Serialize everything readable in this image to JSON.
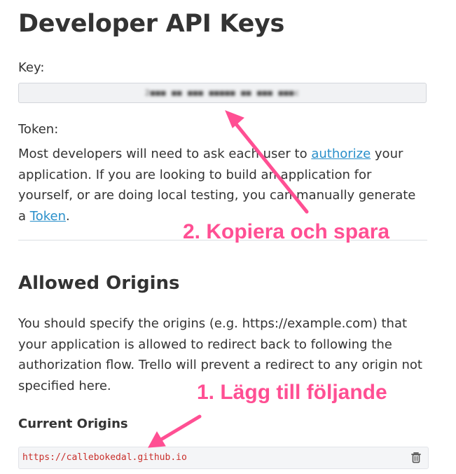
{
  "header": {
    "title": "Developer API Keys"
  },
  "key": {
    "label": "Key:",
    "value": "2■■■ ■■ ■■■ ■■■■■ ■■ ■■■ ■■■c"
  },
  "token": {
    "label": "Token:",
    "text_1": "Most developers will need to ask each user to ",
    "authorize_link": "authorize",
    "text_2": " your application. If you are looking to build an application for yourself, or are doing local testing, you can manually generate a ",
    "token_link": "Token",
    "text_3": "."
  },
  "allowed_origins": {
    "title": "Allowed Origins",
    "description": "You should specify the origins (e.g. https://example.com) that your application is allowed to redirect back to following the authorization flow. Trello will prevent a redirect to any origin not specified here.",
    "current_title": "Current Origins",
    "origins": [
      {
        "url": "https://callebokedal.github.io"
      }
    ]
  },
  "annotations": {
    "copy_save": "2. Kopiera och spara",
    "add_following": "1. Lägg till följande",
    "color": "#ff4f93"
  },
  "icons": {
    "delete": "trash-icon"
  }
}
